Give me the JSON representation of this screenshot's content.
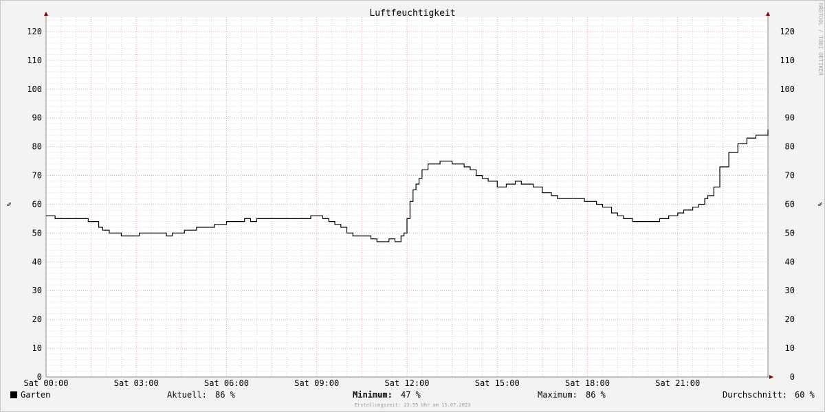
{
  "watermark": "RRDTOOL / TOBI OETIKER",
  "legend": {
    "series_name": "Garten",
    "current_label": "Aktuell:",
    "current_value": "86 %",
    "minimum_label": "Minimum:",
    "minimum_value": "47 %",
    "maximum_label": "Maximum:",
    "maximum_value": "86 %",
    "average_label": "Durchschnitt:",
    "average_value": "60 %"
  },
  "footer": "Erstellungszeit: 23:55 Uhr am 15.07.2023",
  "chart_data": {
    "type": "line",
    "title": "Luftfeuchtigkeit",
    "ylabel": "%",
    "xlim": [
      0,
      24
    ],
    "ylim": [
      0,
      125
    ],
    "grid": true,
    "x_ticks": [
      0,
      3,
      6,
      9,
      12,
      15,
      18,
      21
    ],
    "x_tick_labels": [
      "Sat 00:00",
      "Sat 03:00",
      "Sat 06:00",
      "Sat 09:00",
      "Sat 12:00",
      "Sat 15:00",
      "Sat 18:00",
      "Sat 21:00"
    ],
    "y_ticks": [
      0,
      10,
      20,
      30,
      40,
      50,
      60,
      70,
      80,
      90,
      100,
      110,
      120
    ],
    "series": [
      {
        "name": "Garten",
        "color": "#000000",
        "x": [
          0,
          0.3,
          0.6,
          1.0,
          1.4,
          1.75,
          1.88,
          2.0,
          2.1,
          2.3,
          2.5,
          2.8,
          3.1,
          3.35,
          3.6,
          4.0,
          4.2,
          4.4,
          4.6,
          4.9,
          5.0,
          5.2,
          5.6,
          6.0,
          6.3,
          6.5,
          6.6,
          6.8,
          7.0,
          7.2,
          7.5,
          8.0,
          8.3,
          8.6,
          8.8,
          9.0,
          9.2,
          9.4,
          9.6,
          9.8,
          10.0,
          10.2,
          10.5,
          10.8,
          11.0,
          11.2,
          11.4,
          11.6,
          11.8,
          11.9,
          12.0,
          12.1,
          12.2,
          12.3,
          12.4,
          12.5,
          12.7,
          12.9,
          13.1,
          13.3,
          13.5,
          13.7,
          13.9,
          14.1,
          14.3,
          14.5,
          14.7,
          15.0,
          15.3,
          15.6,
          15.8,
          16.0,
          16.2,
          16.5,
          16.8,
          17.0,
          17.3,
          17.6,
          17.9,
          18.1,
          18.3,
          18.5,
          18.8,
          19.0,
          19.2,
          19.5,
          19.8,
          20.1,
          20.4,
          20.7,
          21.0,
          21.2,
          21.3,
          21.5,
          21.7,
          21.9,
          22.0,
          22.2,
          22.4,
          22.7,
          23.0,
          23.3,
          23.6,
          24.0
        ],
        "y": [
          56,
          55,
          55,
          55,
          54,
          52,
          51,
          51,
          50,
          50,
          49,
          49,
          50,
          50,
          50,
          49,
          50,
          50,
          51,
          51,
          52,
          52,
          53,
          54,
          54,
          54,
          55,
          54,
          55,
          55,
          55,
          55,
          55,
          55,
          56,
          56,
          55,
          54,
          53,
          52,
          50,
          49,
          49,
          48,
          47,
          47,
          48,
          47,
          49,
          50,
          55,
          61,
          65,
          67,
          69,
          72,
          74,
          74,
          75,
          75,
          74,
          74,
          73,
          72,
          70,
          69,
          68,
          66,
          67,
          68,
          67,
          67,
          66,
          64,
          63,
          62,
          62,
          62,
          61,
          61,
          60,
          59,
          57,
          56,
          55,
          54,
          54,
          54,
          55,
          56,
          57,
          58,
          58,
          59,
          60,
          62,
          63,
          66,
          73,
          78,
          81,
          83,
          84,
          86
        ]
      }
    ]
  }
}
